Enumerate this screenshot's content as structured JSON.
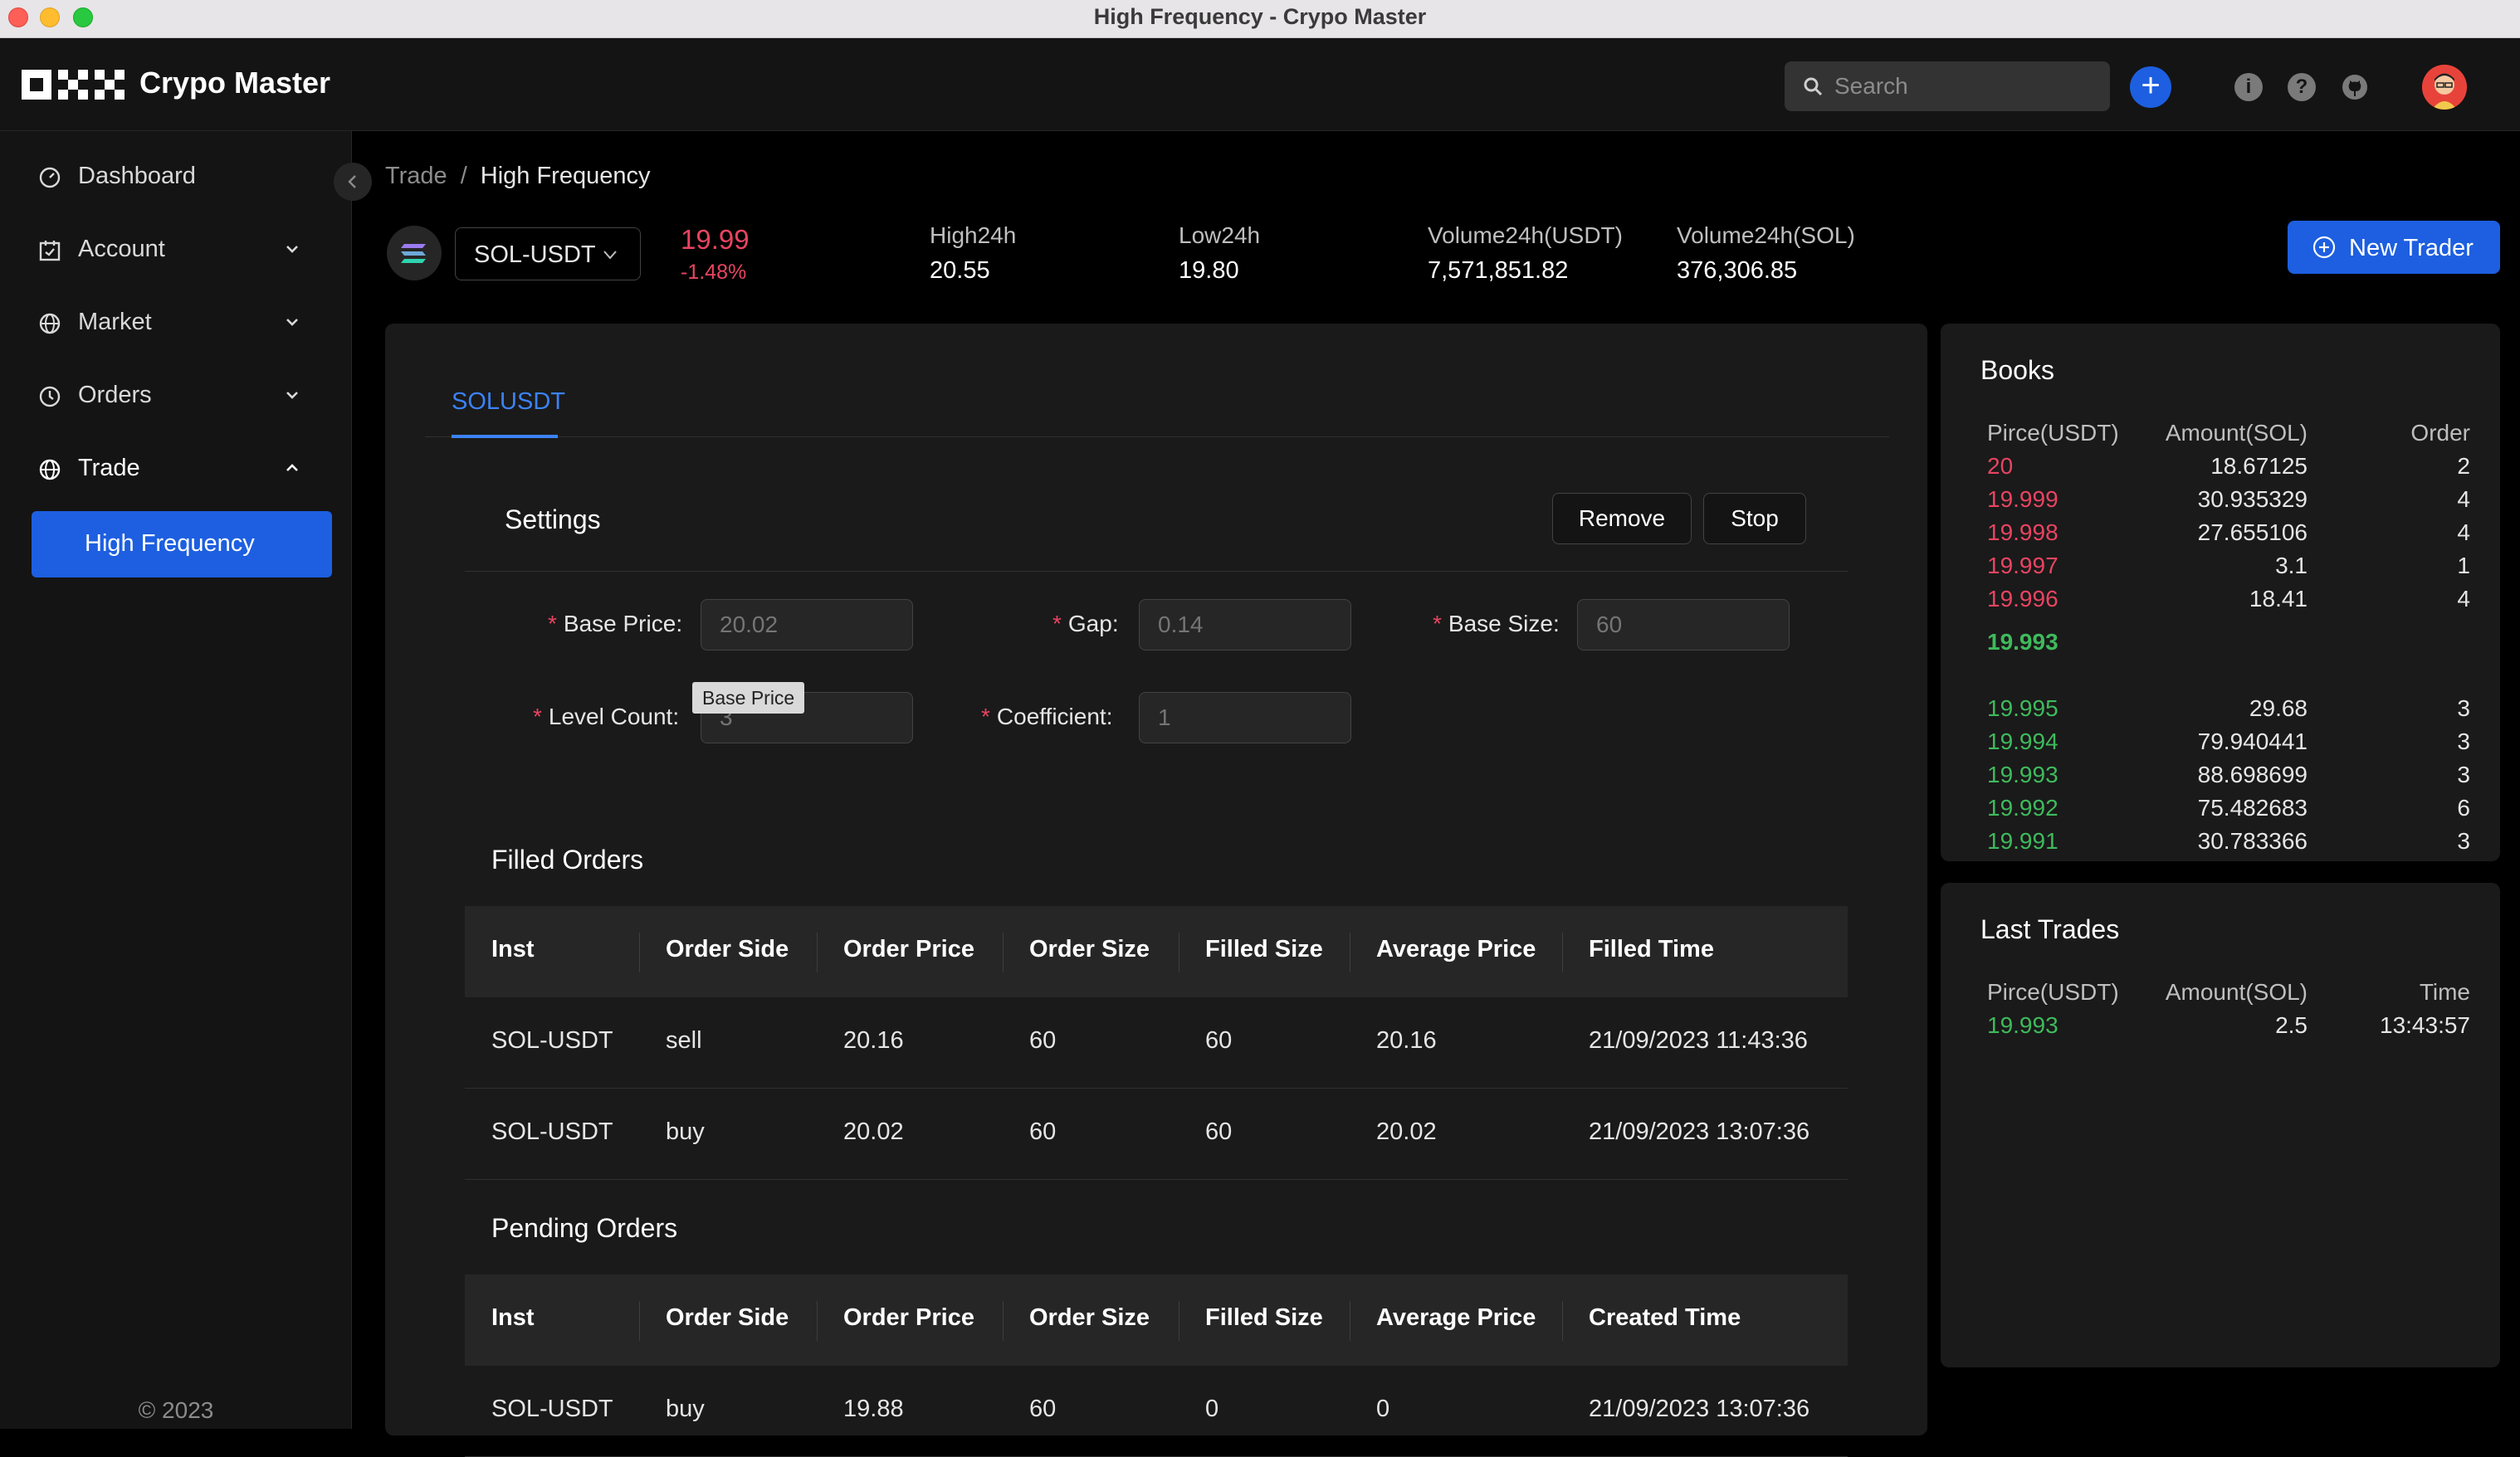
{
  "window": {
    "title": "High Frequency - Crypo Master"
  },
  "header": {
    "app_name": "Crypo Master",
    "search_placeholder": "Search",
    "add_glyph": "+",
    "info_glyph": "i",
    "help_glyph": "?",
    "icons": [
      "info-icon",
      "help-icon",
      "github-icon"
    ]
  },
  "sidebar": {
    "items": [
      {
        "label": "Dashboard",
        "icon": "dashboard-icon",
        "expandable": false
      },
      {
        "label": "Account",
        "icon": "calendar-icon",
        "expandable": true
      },
      {
        "label": "Market",
        "icon": "globe-icon",
        "expandable": true
      },
      {
        "label": "Orders",
        "icon": "clock-icon",
        "expandable": true
      },
      {
        "label": "Trade",
        "icon": "globe-icon",
        "expandable": true,
        "expanded": true
      }
    ],
    "active_sub_item": "High Frequency",
    "copyright": "© 2023"
  },
  "breadcrumb": {
    "parent": "Trade",
    "separator": "/",
    "current": "High Frequency"
  },
  "ticker": {
    "pair": "SOL-USDT",
    "last_price": "19.99",
    "change_pct": "-1.48%",
    "stats": [
      {
        "label": "High24h",
        "value": "20.55"
      },
      {
        "label": "Low24h",
        "value": "19.80"
      },
      {
        "label": "Volume24h(USDT)",
        "value": "7,571,851.82"
      },
      {
        "label": "Volume24h(SOL)",
        "value": "376,306.85"
      }
    ],
    "new_trader_label": "New Trader"
  },
  "main": {
    "tab": "SOLUSDT",
    "settings": {
      "title": "Settings",
      "remove_label": "Remove",
      "stop_label": "Stop",
      "fields": {
        "base_price": {
          "label": "Base Price",
          "placeholder": "20.02"
        },
        "gap": {
          "label": "Gap",
          "placeholder": "0.14"
        },
        "base_size": {
          "label": "Base Size",
          "placeholder": "60"
        },
        "level_count": {
          "label": "Level Count",
          "placeholder": "3"
        },
        "coefficient": {
          "label": "Coefficient",
          "placeholder": "1"
        }
      },
      "tooltip": "Base Price",
      "colon": ":",
      "required_mark": "*"
    },
    "filled_orders": {
      "title": "Filled Orders",
      "columns": [
        "Inst",
        "Order Side",
        "Order Price",
        "Order Size",
        "Filled Size",
        "Average Price",
        "Filled Time"
      ],
      "rows": [
        [
          "SOL-USDT",
          "sell",
          "20.16",
          "60",
          "60",
          "20.16",
          "21/09/2023 11:43:36"
        ],
        [
          "SOL-USDT",
          "buy",
          "20.02",
          "60",
          "60",
          "20.02",
          "21/09/2023 13:07:36"
        ]
      ]
    },
    "pending_orders": {
      "title": "Pending Orders",
      "columns": [
        "Inst",
        "Order Side",
        "Order Price",
        "Order Size",
        "Filled Size",
        "Average Price",
        "Created Time"
      ],
      "rows": [
        [
          "SOL-USDT",
          "buy",
          "19.88",
          "60",
          "0",
          "0",
          "21/09/2023 13:07:36"
        ]
      ]
    }
  },
  "books": {
    "title": "Books",
    "columns": [
      "Pirce(USDT)",
      "Amount(SOL)",
      "Order"
    ],
    "asks": [
      [
        "20",
        "18.67125",
        "2"
      ],
      [
        "19.999",
        "30.935329",
        "4"
      ],
      [
        "19.998",
        "27.655106",
        "4"
      ],
      [
        "19.997",
        "3.1",
        "1"
      ],
      [
        "19.996",
        "18.41",
        "4"
      ]
    ],
    "mid_price": "19.993",
    "bids": [
      [
        "19.995",
        "29.68",
        "3"
      ],
      [
        "19.994",
        "79.940441",
        "3"
      ],
      [
        "19.993",
        "88.698699",
        "3"
      ],
      [
        "19.992",
        "75.482683",
        "6"
      ],
      [
        "19.991",
        "30.783366",
        "3"
      ]
    ]
  },
  "last_trades": {
    "title": "Last Trades",
    "columns": [
      "Pirce(USDT)",
      "Amount(SOL)",
      "Time"
    ],
    "rows": [
      [
        "19.993",
        "2.5",
        "13:43:57"
      ]
    ]
  },
  "colors": {
    "accent": "#1d5fe0",
    "down": "#e84461",
    "up": "#3fba5c",
    "panel": "#1a1a1a",
    "background": "#000000"
  }
}
